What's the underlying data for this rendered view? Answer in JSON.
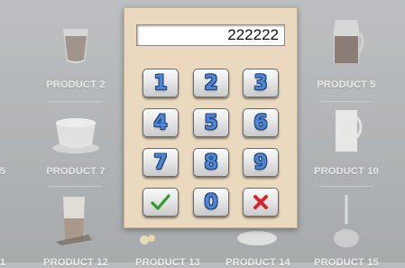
{
  "products": [
    {
      "id": "p2",
      "label": "PRODUCT 2"
    },
    {
      "id": "p5",
      "label": "PRODUCT 5"
    },
    {
      "id": "p7",
      "label": "PRODUCT 7"
    },
    {
      "id": "p10",
      "label": "PRODUCT 10"
    },
    {
      "id": "p12",
      "label": "PRODUCT 12"
    },
    {
      "id": "p13",
      "label": "PRODUCT 13"
    },
    {
      "id": "p14",
      "label": "PRODUCT 14"
    },
    {
      "id": "p15",
      "label": "PRODUCT 15"
    }
  ],
  "edge_labels": {
    "left_mid": "5",
    "left_bottom": "1"
  },
  "keypad": {
    "display_value": "222222",
    "keys": [
      "1",
      "2",
      "3",
      "4",
      "5",
      "6",
      "7",
      "8",
      "9"
    ],
    "zero": "0",
    "confirm_icon": "check-icon",
    "cancel_icon": "x-icon",
    "colors": {
      "digit": "#4e86d4",
      "confirm": "#2e9b2e",
      "cancel": "#d8242a",
      "panel": "#ead8bf"
    }
  }
}
